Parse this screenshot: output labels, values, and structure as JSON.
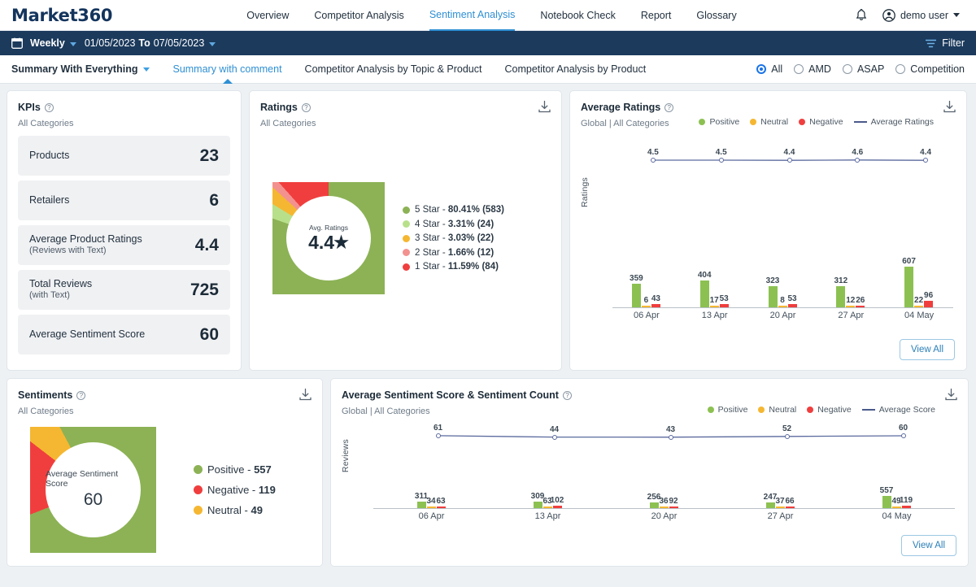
{
  "brand": "Market360",
  "nav": {
    "links": [
      {
        "label": "Overview",
        "active": false
      },
      {
        "label": "Competitor Analysis",
        "active": false
      },
      {
        "label": "Sentiment Analysis",
        "active": true
      },
      {
        "label": "Notebook Check",
        "active": false
      },
      {
        "label": "Report",
        "active": false
      },
      {
        "label": "Glossary",
        "active": false
      }
    ],
    "user": "demo user"
  },
  "datebar": {
    "period": "Weekly",
    "from": "01/05/2023",
    "to_label": "To",
    "to": "07/05/2023",
    "filter_label": "Filter"
  },
  "subbar": {
    "tabs": [
      {
        "label": "Summary With Everything",
        "active": false,
        "bold": true,
        "caret": true
      },
      {
        "label": "Summary with comment",
        "active": true,
        "bold": false,
        "caret": false
      },
      {
        "label": "Competitor Analysis by Topic & Product",
        "active": false,
        "bold": false,
        "caret": false
      },
      {
        "label": "Competitor Analysis by Product",
        "active": false,
        "bold": false,
        "caret": false
      }
    ],
    "radios": [
      {
        "label": "All",
        "selected": true
      },
      {
        "label": "AMD",
        "selected": false
      },
      {
        "label": "ASAP",
        "selected": false
      },
      {
        "label": "Competition",
        "selected": false
      }
    ]
  },
  "kpi_card": {
    "title": "KPIs",
    "subtitle": "All Categories",
    "items": [
      {
        "label": "Products",
        "sublabel": "",
        "value": "23"
      },
      {
        "label": "Retailers",
        "sublabel": "",
        "value": "6"
      },
      {
        "label": "Average Product Ratings",
        "sublabel": "(Reviews with Text)",
        "value": "4.4"
      },
      {
        "label": "Total Reviews",
        "sublabel": "(with Text)",
        "value": "725"
      },
      {
        "label": "Average Sentiment Score",
        "sublabel": "",
        "value": "60"
      }
    ]
  },
  "ratings_card": {
    "title": "Ratings",
    "subtitle": "All Categories",
    "center_caption": "Avg. Ratings",
    "center_value": "4.4",
    "center_star": "★"
  },
  "avg_ratings_card": {
    "title": "Average Ratings",
    "subtitle": "Global | All Categories",
    "legend": [
      {
        "label": "Positive",
        "color": "#8cc152",
        "type": "dot"
      },
      {
        "label": "Neutral",
        "color": "#f5b731",
        "type": "dot"
      },
      {
        "label": "Negative",
        "color": "#f03e3e",
        "type": "dot"
      },
      {
        "label": "Average Ratings",
        "color": "#4a5a8a",
        "type": "line"
      }
    ],
    "view_all": "View All"
  },
  "sentiments_card": {
    "title": "Sentiments",
    "subtitle": "All Categories",
    "center_caption": "Average Sentiment Score",
    "center_value": "60"
  },
  "avg_sentiment_card": {
    "title": "Average Sentiment Score & Sentiment Count",
    "subtitle": "Global | All Categories",
    "legend": [
      {
        "label": "Positive",
        "color": "#8cc152",
        "type": "dot"
      },
      {
        "label": "Neutral",
        "color": "#f5b731",
        "type": "dot"
      },
      {
        "label": "Negative",
        "color": "#f03e3e",
        "type": "dot"
      },
      {
        "label": "Average Score",
        "color": "#4a5a8a",
        "type": "line"
      }
    ],
    "view_all": "View All"
  },
  "chart_data": [
    {
      "id": "ratings_donut",
      "type": "pie",
      "title": "Ratings",
      "subtitle": "All Categories",
      "center_label": "Avg. Ratings",
      "center_value": 4.4,
      "legend_position": "right",
      "slices": [
        {
          "label": "5 Star",
          "percent": 80.41,
          "count": 583,
          "color": "#8cb255",
          "text": "5 Star - 80.41% (583)"
        },
        {
          "label": "4 Star",
          "percent": 3.31,
          "count": 24,
          "color": "#b8e08a",
          "text": "4 Star - 3.31% (24)"
        },
        {
          "label": "3 Star",
          "percent": 3.03,
          "count": 22,
          "color": "#f5b731",
          "text": "3 Star - 3.03% (22)"
        },
        {
          "label": "2 Star",
          "percent": 1.66,
          "count": 12,
          "color": "#f3918f",
          "text": "2 Star - 1.66% (12)"
        },
        {
          "label": "1 Star",
          "percent": 11.59,
          "count": 84,
          "color": "#f03e3e",
          "text": "1 Star - 11.59% (84)"
        }
      ]
    },
    {
      "id": "sentiments_donut",
      "type": "pie",
      "title": "Sentiments",
      "subtitle": "All Categories",
      "center_label": "Average Sentiment Score",
      "center_value": 60,
      "legend_position": "right",
      "slices": [
        {
          "label": "Positive",
          "count": 557,
          "color": "#8cb255",
          "text": "Positive - 557"
        },
        {
          "label": "Negative",
          "count": 119,
          "color": "#f03e3e",
          "text": "Negative - 119"
        },
        {
          "label": "Neutral",
          "count": 49,
          "color": "#f5b731",
          "text": "Neutral - 49"
        }
      ]
    },
    {
      "id": "average_ratings",
      "type": "bar",
      "title": "Average Ratings",
      "subtitle": "Global | All Categories",
      "xlabel": "",
      "ylabel": "Ratings",
      "categories": [
        "06 Apr",
        "13 Apr",
        "20 Apr",
        "27 Apr",
        "04 May"
      ],
      "ylim": [
        0,
        700
      ],
      "grid": false,
      "legend_position": "top-right",
      "series": [
        {
          "name": "Positive",
          "color": "#8cc152",
          "values": [
            359,
            404,
            323,
            312,
            607
          ]
        },
        {
          "name": "Neutral",
          "color": "#f5b731",
          "values": [
            6,
            17,
            8,
            12,
            22
          ]
        },
        {
          "name": "Negative",
          "color": "#f03e3e",
          "values": [
            43,
            53,
            53,
            26,
            96
          ]
        }
      ],
      "line_series": {
        "name": "Average Ratings",
        "color": "#5b6a9e",
        "values": [
          4.5,
          4.5,
          4.4,
          4.6,
          4.4
        ],
        "ylim": [
          0,
          5
        ]
      }
    },
    {
      "id": "average_sentiment_score_count",
      "type": "bar",
      "title": "Average Sentiment Score & Sentiment Count",
      "subtitle": "Global | All Categories",
      "xlabel": "",
      "ylabel": "Reviews",
      "categories": [
        "06 Apr",
        "13 Apr",
        "20 Apr",
        "27 Apr",
        "04 May"
      ],
      "ylim": [
        0,
        600
      ],
      "grid": false,
      "legend_position": "top-right",
      "series": [
        {
          "name": "Positive",
          "color": "#8cc152",
          "values": [
            311,
            309,
            256,
            247,
            557
          ]
        },
        {
          "name": "Neutral",
          "color": "#f5b731",
          "values": [
            34,
            63,
            36,
            37,
            49
          ]
        },
        {
          "name": "Negative",
          "color": "#f03e3e",
          "values": [
            63,
            102,
            92,
            66,
            119
          ]
        }
      ],
      "line_series": {
        "name": "Average Score",
        "color": "#5b6a9e",
        "values": [
          61,
          44,
          43,
          52,
          60
        ],
        "ylim": [
          0,
          100
        ]
      }
    }
  ]
}
